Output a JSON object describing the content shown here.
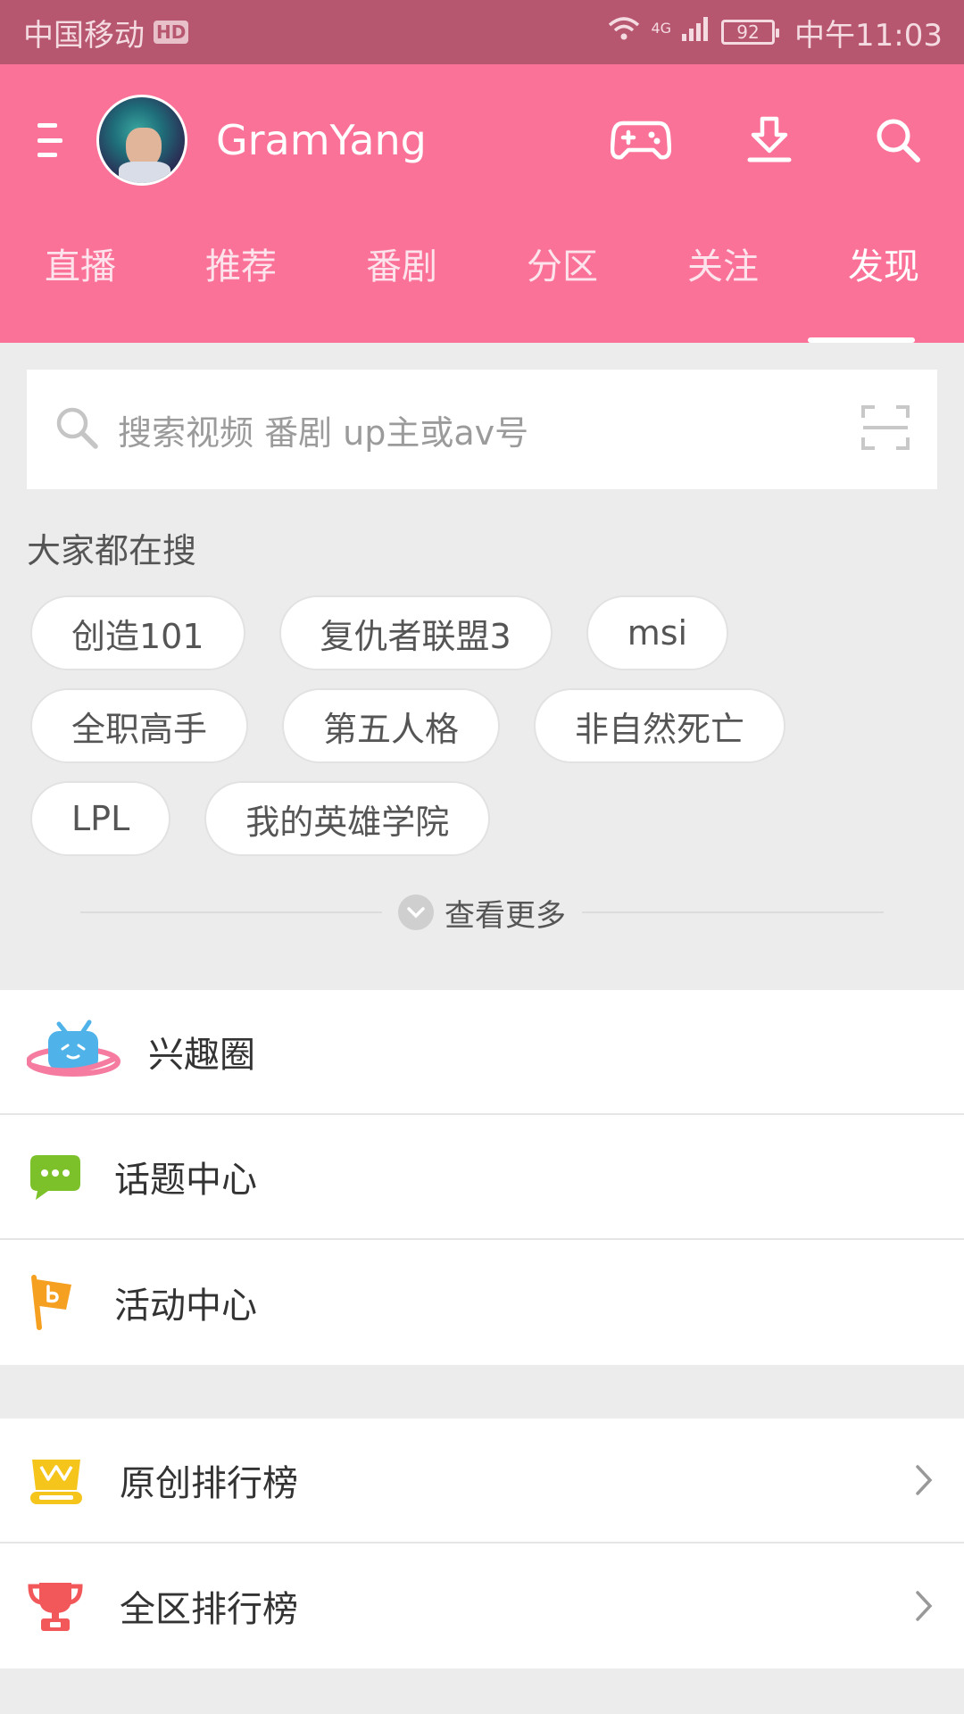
{
  "status_bar": {
    "carrier": "中国移动",
    "hd_badge": "HD",
    "network": "4G",
    "battery": "92",
    "time": "中午11:03"
  },
  "header": {
    "username": "GramYang",
    "icons": [
      "menu-icon",
      "avatar",
      "gamepad-icon",
      "download-icon",
      "search-icon"
    ]
  },
  "tabs": [
    {
      "label": "直播"
    },
    {
      "label": "推荐"
    },
    {
      "label": "番剧"
    },
    {
      "label": "分区"
    },
    {
      "label": "关注"
    },
    {
      "label": "发现",
      "active": true
    }
  ],
  "search": {
    "placeholder": "搜索视频 番剧 up主或av号"
  },
  "hot_search": {
    "title": "大家都在搜",
    "tags": [
      [
        "创造101",
        "复仇者联盟3",
        "msi"
      ],
      [
        "全职高手",
        "第五人格",
        "非自然死亡"
      ],
      [
        "LPL",
        "我的英雄学院"
      ]
    ],
    "more_label": "查看更多"
  },
  "menu_group_1": [
    {
      "label": "兴趣圈",
      "icon": "planet-tv-icon"
    },
    {
      "label": "话题中心",
      "icon": "chat-bubble-icon"
    },
    {
      "label": "活动中心",
      "icon": "flag-icon"
    }
  ],
  "menu_group_2": [
    {
      "label": "原创排行榜",
      "icon": "original-crown-icon"
    },
    {
      "label": "全区排行榜",
      "icon": "trophy-icon"
    }
  ],
  "colors": {
    "brand_pink": "#fb7299",
    "status_bar": "#b7566f",
    "background": "#ececec"
  }
}
